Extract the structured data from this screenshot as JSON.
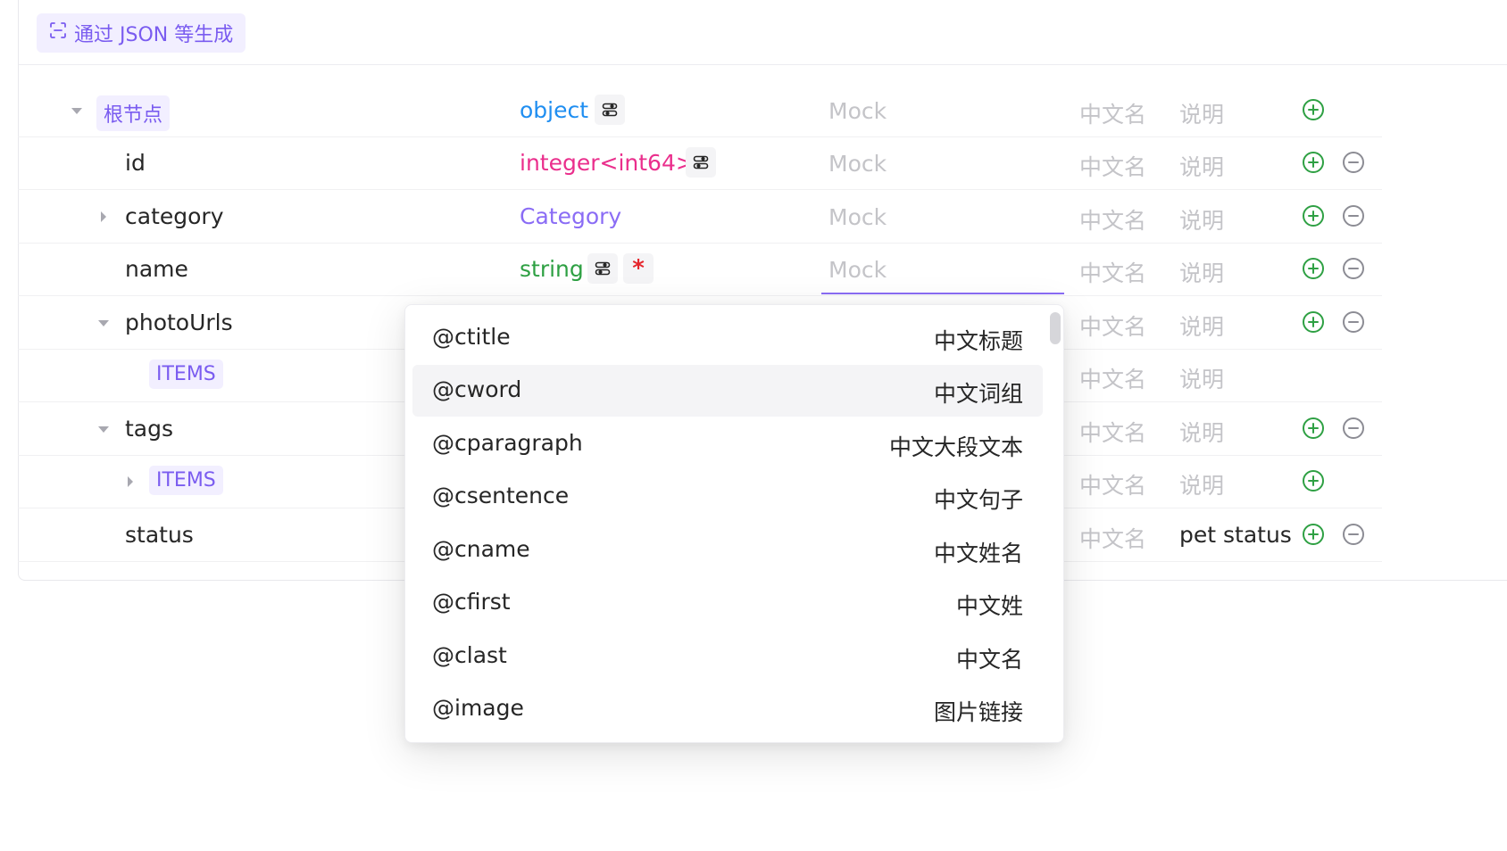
{
  "toolbar": {
    "generate_label": "通过 JSON 等生成"
  },
  "rows": [
    {
      "name": "根节点",
      "type": "object",
      "mock": "Mock",
      "cn": "中文名",
      "desc": "说明"
    },
    {
      "name": "id",
      "type": "integer<int64>",
      "mock": "Mock",
      "cn": "中文名",
      "desc": "说明"
    },
    {
      "name": "category",
      "type": "Category",
      "mock": "Mock",
      "cn": "中文名",
      "desc": "说明"
    },
    {
      "name": "name",
      "type": "string",
      "required_mark": "*",
      "mock": "Mock",
      "cn": "中文名",
      "desc": "说明"
    },
    {
      "name": "photoUrls",
      "cn": "中文名",
      "desc": "说明"
    },
    {
      "name": "ITEMS",
      "cn": "中文名",
      "desc": "说明"
    },
    {
      "name": "tags",
      "cn": "中文名",
      "desc": "说明"
    },
    {
      "name": "ITEMS",
      "cn": "中文名",
      "desc": "说明"
    },
    {
      "name": "status",
      "cn": "中文名",
      "desc": "pet status"
    }
  ],
  "mock_dropdown": {
    "options": [
      {
        "key": "@ctitle",
        "label": "中文标题"
      },
      {
        "key": "@cword",
        "label": "中文词组"
      },
      {
        "key": "@cparagraph",
        "label": "中文大段文本"
      },
      {
        "key": "@csentence",
        "label": "中文句子"
      },
      {
        "key": "@cname",
        "label": "中文姓名"
      },
      {
        "key": "@cfirst",
        "label": "中文姓"
      },
      {
        "key": "@clast",
        "label": "中文名"
      },
      {
        "key": "@image",
        "label": "图片链接"
      }
    ],
    "hovered_index": 1
  },
  "colors": {
    "accent": "#7a5cf0",
    "type_object": "#1f8ef1",
    "type_integer": "#ea2e8c",
    "type_ref": "#8a6cf5",
    "type_string": "#2ea043",
    "add_icon": "#2ea043",
    "remove_icon": "#8c8c94",
    "required": "#e5262d"
  },
  "icons": {
    "generate": "scan-icon",
    "type_settings": "settings-toggle-icon",
    "add": "plus-circle-icon",
    "remove": "minus-circle-icon",
    "expand": "caret-icon"
  }
}
